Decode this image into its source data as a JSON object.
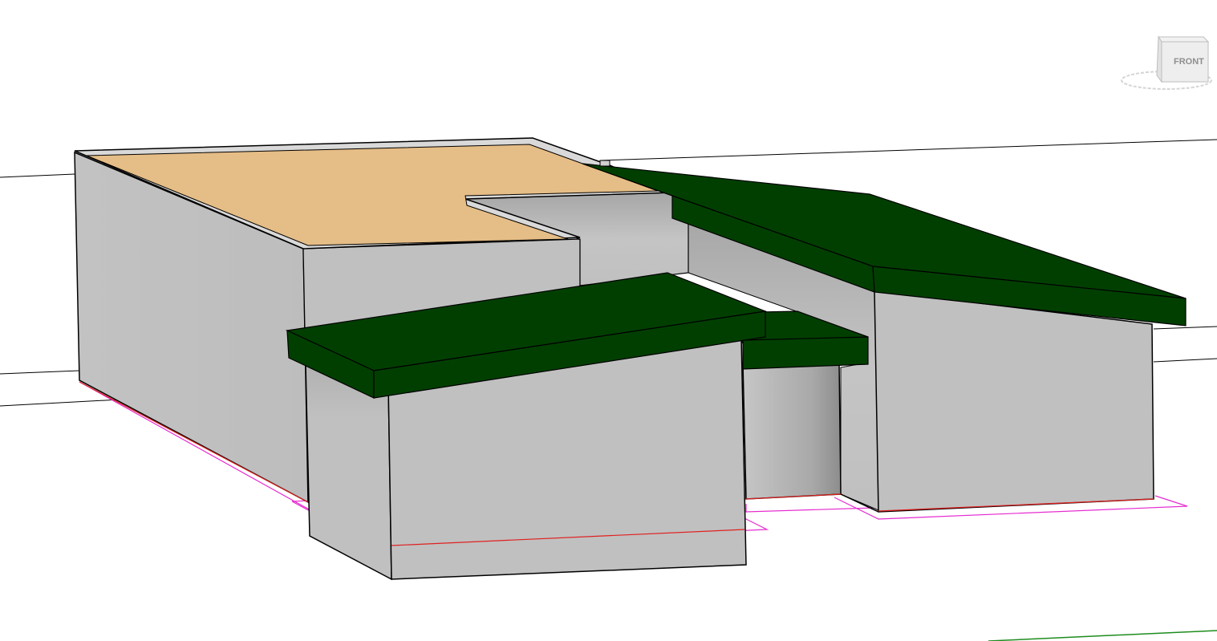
{
  "viewcube": {
    "face_label": "FRONT",
    "icon": "view-cube-icon"
  },
  "colors": {
    "background": "#ffffff",
    "wall": "#c0c0c0",
    "wall_shadow": "#9a9a9a",
    "roof_green": "#013f01",
    "flat_roof_tan": "#e5bd86",
    "edge": "#000000",
    "sketch_magenta": "#e52bd0",
    "base_red": "#e02020",
    "grid_green": "#1e8c1e"
  }
}
